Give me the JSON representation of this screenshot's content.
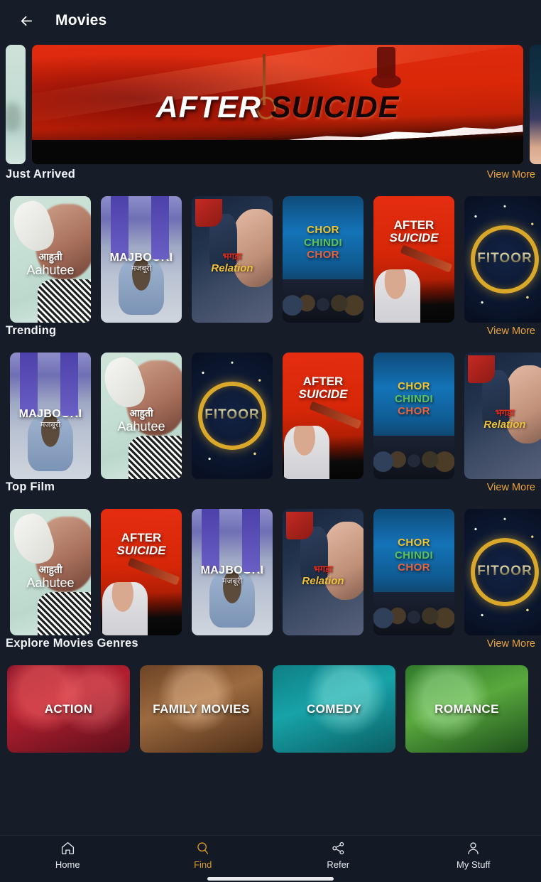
{
  "header": {
    "title": "Movies",
    "back_icon": "arrow-left-icon"
  },
  "banner": {
    "active_slide": {
      "title_word1": "AFTER",
      "title_word2": "SUICIDE"
    }
  },
  "sections": [
    {
      "title": "Just Arrived",
      "view_more": "View More",
      "posters": [
        {
          "art": "art-aahutee",
          "text_class": "txt-aahutee",
          "line1": "आहुती",
          "line2": "Aahutee"
        },
        {
          "art": "art-majboori",
          "text_class": "txt-majboori",
          "line1": "MAJBOORI",
          "line2": "मजबूरी"
        },
        {
          "art": "art-relation",
          "text_class": "txt-relation",
          "line1": "भगड़ा",
          "line2": "Relation"
        },
        {
          "art": "art-chor",
          "text_class": "txt-chor",
          "line1": "CHOR",
          "line2": "CHINDI",
          "line3": "CHOR"
        },
        {
          "art": "art-after",
          "text_class": "txt-after",
          "line1": "AFTER",
          "line2": "SUICIDE"
        },
        {
          "art": "art-fitoor",
          "text_class": "txt-fitoor",
          "line1": "FITOOR"
        }
      ]
    },
    {
      "title": "Trending",
      "view_more": "View More",
      "posters": [
        {
          "art": "art-majboori",
          "text_class": "txt-majboori",
          "line1": "MAJBOORI",
          "line2": "मजबूरी"
        },
        {
          "art": "art-aahutee",
          "text_class": "txt-aahutee",
          "line1": "आहुती",
          "line2": "Aahutee"
        },
        {
          "art": "art-fitoor",
          "text_class": "txt-fitoor",
          "line1": "FITOOR"
        },
        {
          "art": "art-after",
          "text_class": "txt-after",
          "line1": "AFTER",
          "line2": "SUICIDE"
        },
        {
          "art": "art-chor",
          "text_class": "txt-chor",
          "line1": "CHOR",
          "line2": "CHINDI",
          "line3": "CHOR"
        },
        {
          "art": "art-relation",
          "text_class": "txt-relation",
          "line1": "भगड़ा",
          "line2": "Relation"
        }
      ]
    },
    {
      "title": "Top Film",
      "view_more": "View More",
      "posters": [
        {
          "art": "art-aahutee",
          "text_class": "txt-aahutee",
          "line1": "आहुती",
          "line2": "Aahutee"
        },
        {
          "art": "art-after",
          "text_class": "txt-after",
          "line1": "AFTER",
          "line2": "SUICIDE"
        },
        {
          "art": "art-majboori",
          "text_class": "txt-majboori",
          "line1": "MAJBOORI",
          "line2": "मजबूरी"
        },
        {
          "art": "art-relation",
          "text_class": "txt-relation",
          "line1": "भगड़ा",
          "line2": "Relation"
        },
        {
          "art": "art-chor",
          "text_class": "txt-chor",
          "line1": "CHOR",
          "line2": "CHINDI",
          "line3": "CHOR"
        },
        {
          "art": "art-fitoor",
          "text_class": "txt-fitoor",
          "line1": "FITOOR"
        }
      ]
    }
  ],
  "genres_section": {
    "title": "Explore Movies Genres",
    "view_more": "View More",
    "cards": [
      {
        "label": "ACTION",
        "style": "g-action"
      },
      {
        "label": "FAMILY MOVIES",
        "style": "g-family"
      },
      {
        "label": "COMEDY",
        "style": "g-comedy"
      },
      {
        "label": "ROMANCE",
        "style": "g-romance"
      }
    ]
  },
  "bottom_nav": {
    "items": [
      {
        "label": "Home",
        "icon": "home-icon",
        "active": false
      },
      {
        "label": "Find",
        "icon": "search-icon",
        "active": true
      },
      {
        "label": "Refer",
        "icon": "share-icon",
        "active": false
      },
      {
        "label": "My Stuff",
        "icon": "person-icon",
        "active": false
      }
    ]
  },
  "colors": {
    "background": "#161d29",
    "accent": "#e8a33d",
    "nav_active": "#d99a23",
    "text_primary": "#f2f4f8"
  }
}
